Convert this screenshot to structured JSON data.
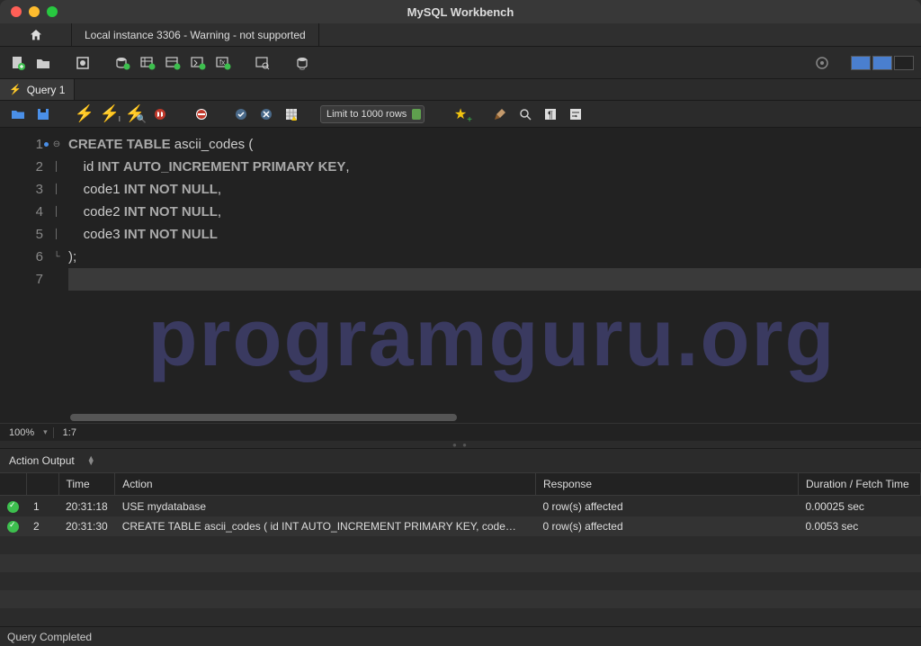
{
  "window": {
    "title": "MySQL Workbench"
  },
  "connection_tab": {
    "label": "Local instance 3306 - Warning - not supported"
  },
  "query_tab": {
    "label": "Query 1"
  },
  "editor_toolbar": {
    "limit": "Limit to 1000 rows"
  },
  "code": {
    "lines": [
      "CREATE TABLE ascii_codes (",
      "    id INT AUTO_INCREMENT PRIMARY KEY,",
      "    code1 INT NOT NULL,",
      "    code2 INT NOT NULL,",
      "    code3 INT NOT NULL",
      ");",
      ""
    ]
  },
  "watermark": "programguru.org",
  "editor_status": {
    "zoom": "100%",
    "pos": "1:7"
  },
  "output": {
    "title": "Action Output",
    "headers": {
      "num": "",
      "time": "Time",
      "action": "Action",
      "response": "Response",
      "duration": "Duration / Fetch Time"
    },
    "rows": [
      {
        "num": "1",
        "time": "20:31:18",
        "action": "USE mydatabase",
        "response": "0 row(s) affected",
        "duration": "0.00025 sec"
      },
      {
        "num": "2",
        "time": "20:31:30",
        "action": "CREATE TABLE ascii_codes (     id INT AUTO_INCREMENT PRIMARY KEY,     code…",
        "response": "0 row(s) affected",
        "duration": "0.0053 sec"
      }
    ]
  },
  "status_bar": {
    "text": "Query Completed"
  }
}
